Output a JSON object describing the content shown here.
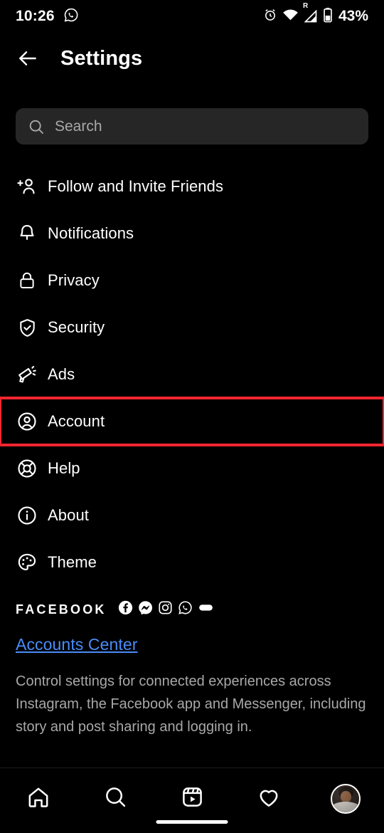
{
  "status_bar": {
    "time": "10:26",
    "whatsapp_icon": "whatsapp-icon",
    "alarm_icon": "alarm-icon",
    "wifi_icon": "wifi-icon",
    "signal_icon": "cell-signal-icon",
    "roaming_indicator": "R",
    "battery_icon": "battery-icon",
    "battery_percent": "43%"
  },
  "header": {
    "back_icon": "back-arrow-icon",
    "title": "Settings"
  },
  "search": {
    "icon": "search-icon",
    "placeholder": "Search",
    "value": ""
  },
  "menu": {
    "items": [
      {
        "label": "Follow and Invite Friends",
        "icon": "add-person-icon",
        "highlighted": false
      },
      {
        "label": "Notifications",
        "icon": "bell-icon",
        "highlighted": false
      },
      {
        "label": "Privacy",
        "icon": "lock-icon",
        "highlighted": false
      },
      {
        "label": "Security",
        "icon": "shield-check-icon",
        "highlighted": false
      },
      {
        "label": "Ads",
        "icon": "megaphone-icon",
        "highlighted": false
      },
      {
        "label": "Account",
        "icon": "account-circle-icon",
        "highlighted": true
      },
      {
        "label": "Help",
        "icon": "life-ring-icon",
        "highlighted": false
      },
      {
        "label": "About",
        "icon": "info-circle-icon",
        "highlighted": false
      },
      {
        "label": "Theme",
        "icon": "palette-icon",
        "highlighted": false
      }
    ]
  },
  "facebook_section": {
    "wordmark": "FACEBOOK",
    "app_icons": [
      "facebook-icon",
      "messenger-icon",
      "instagram-icon",
      "whatsapp-icon",
      "oculus-icon"
    ],
    "accounts_center_label": "Accounts Center",
    "description": "Control settings for connected experiences across Instagram, the Facebook app and Messenger, including story and post sharing and logging in."
  },
  "bottom_nav": {
    "items": [
      {
        "name": "home",
        "icon": "home-icon"
      },
      {
        "name": "search",
        "icon": "search-icon"
      },
      {
        "name": "reels",
        "icon": "reels-icon"
      },
      {
        "name": "activity",
        "icon": "heart-icon"
      },
      {
        "name": "profile",
        "icon": "avatar-icon"
      }
    ]
  },
  "colors": {
    "background": "#000000",
    "highlight_red": "#f4252f",
    "link_blue": "#4a8cf7",
    "search_field": "#262626",
    "secondary_text": "#a8a8a8"
  }
}
